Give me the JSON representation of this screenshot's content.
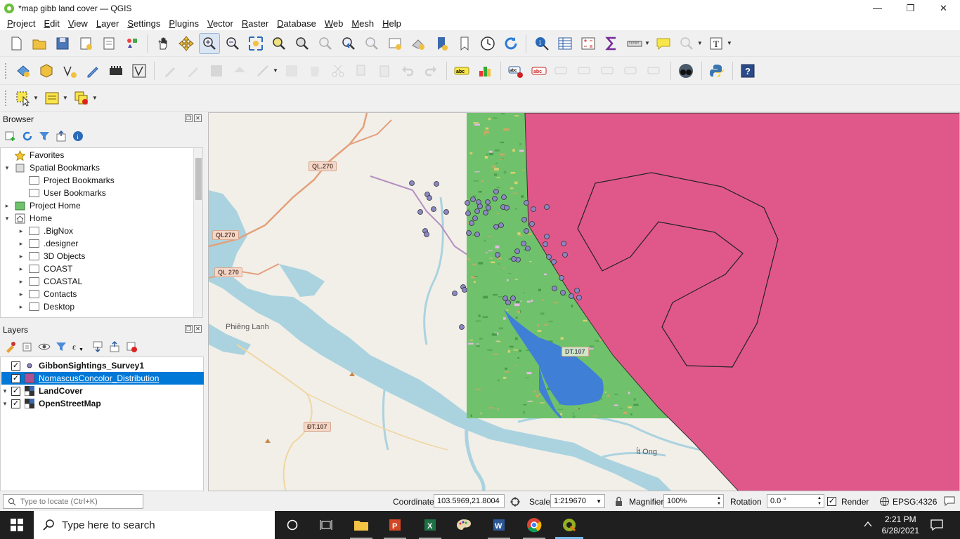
{
  "window": {
    "title": "*map gibb land cover — QGIS",
    "min": "—",
    "max": "❐",
    "close": "✕"
  },
  "menu": [
    "Project",
    "Edit",
    "View",
    "Layer",
    "Settings",
    "Plugins",
    "Vector",
    "Raster",
    "Database",
    "Web",
    "Mesh",
    "Help"
  ],
  "browser": {
    "title": "Browser",
    "items": [
      {
        "label": "Favorites",
        "indent": 0,
        "twisty": "",
        "icon": "star-icon"
      },
      {
        "label": "Spatial Bookmarks",
        "indent": 0,
        "twisty": "▾",
        "icon": "bookmark-icon"
      },
      {
        "label": "Project Bookmarks",
        "indent": 1,
        "twisty": "",
        "icon": "folder-icon"
      },
      {
        "label": "User Bookmarks",
        "indent": 1,
        "twisty": "",
        "icon": "folder-icon"
      },
      {
        "label": "Project Home",
        "indent": 0,
        "twisty": "▸",
        "icon": "project-home-icon"
      },
      {
        "label": "Home",
        "indent": 0,
        "twisty": "▾",
        "icon": "home-icon"
      },
      {
        "label": ".BigNox",
        "indent": 1,
        "twisty": "▸",
        "icon": "folder-icon"
      },
      {
        "label": ".designer",
        "indent": 1,
        "twisty": "▸",
        "icon": "folder-icon"
      },
      {
        "label": "3D Objects",
        "indent": 1,
        "twisty": "▸",
        "icon": "folder-icon"
      },
      {
        "label": "COAST",
        "indent": 1,
        "twisty": "▸",
        "icon": "folder-icon"
      },
      {
        "label": "COASTAL",
        "indent": 1,
        "twisty": "▸",
        "icon": "folder-icon"
      },
      {
        "label": "Contacts",
        "indent": 1,
        "twisty": "▸",
        "icon": "folder-icon"
      },
      {
        "label": "Desktop",
        "indent": 1,
        "twisty": "▸",
        "icon": "folder-icon"
      }
    ]
  },
  "layers": {
    "title": "Layers",
    "items": [
      {
        "label": "GibbonSightings_Survey1",
        "checked": "✓",
        "twisty": "",
        "symbol": "point",
        "selected": false
      },
      {
        "label": "NomascusConcolor_Distribution",
        "checked": "✓",
        "twisty": "",
        "symbol": "polygon",
        "selected": true
      },
      {
        "label": "LandCover",
        "checked": "✓",
        "twisty": "▾",
        "symbol": "raster",
        "selected": false
      },
      {
        "label": "OpenStreetMap",
        "checked": "✓",
        "twisty": "▾",
        "symbol": "raster",
        "selected": false
      }
    ]
  },
  "map": {
    "road_labels": [
      "QL.270",
      "QL270",
      "QL 270",
      "ĐT.107",
      "DT.107"
    ],
    "place_labels": [
      "Phiêng Lanh",
      "Ít Ong"
    ],
    "colors": {
      "distribution": "#e0588a",
      "landcover_green": "#6fc26b",
      "water": "#3f7fd6",
      "sighting": "#8a87c4"
    }
  },
  "status": {
    "locate_placeholder": "Type to locate (Ctrl+K)",
    "coordinate_label": "Coordinate",
    "coordinate_value": "103.5969,21.8004",
    "scale_label": "Scale",
    "scale_value": "1:219670",
    "magnifier_label": "Magnifier",
    "magnifier_value": "100%",
    "rotation_label": "Rotation",
    "rotation_value": "0.0 °",
    "render_label": "Render",
    "crs": "EPSG:4326"
  },
  "taskbar": {
    "search_placeholder": "Type here to search",
    "time": "2:21 PM",
    "date": "6/28/2021"
  }
}
